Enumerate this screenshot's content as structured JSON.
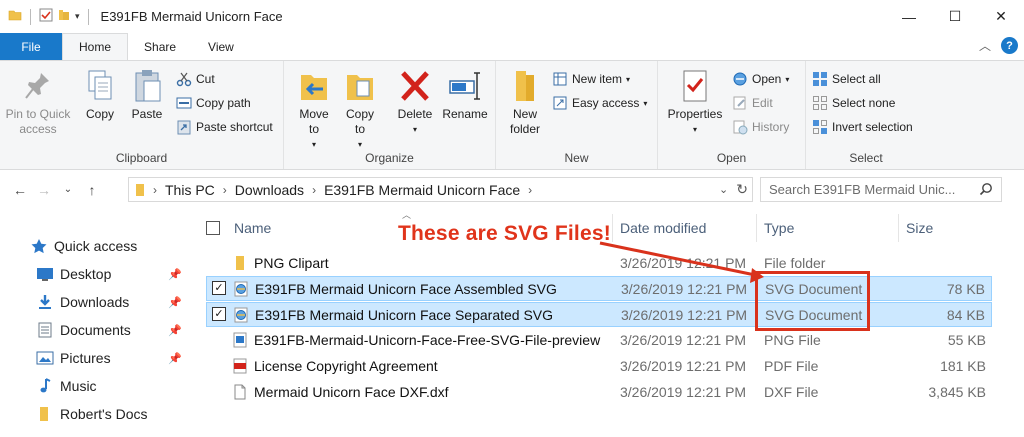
{
  "window": {
    "title": "E391FB Mermaid Unicorn Face",
    "minimize": "—",
    "maximize": "☐",
    "close": "✕"
  },
  "tabs": [
    "File",
    "Home",
    "Share",
    "View"
  ],
  "ribbon": {
    "clipboard": {
      "label": "Clipboard",
      "pin_quick_access": "Pin to Quick access",
      "copy": "Copy",
      "paste": "Paste",
      "cut": "Cut",
      "copy_path": "Copy path",
      "paste_shortcut": "Paste shortcut"
    },
    "organize": {
      "label": "Organize",
      "move_to": "Move to",
      "copy_to": "Copy to",
      "delete": "Delete",
      "rename": "Rename"
    },
    "new": {
      "label": "New",
      "new_folder": "New folder",
      "new_item": "New item",
      "easy_access": "Easy access"
    },
    "open": {
      "label": "Open",
      "properties": "Properties",
      "open": "Open",
      "edit": "Edit",
      "history": "History"
    },
    "select": {
      "label": "Select",
      "select_all": "Select all",
      "select_none": "Select none",
      "invert_selection": "Invert selection"
    }
  },
  "address": {
    "crumbs": [
      "This PC",
      "Downloads",
      "E391FB Mermaid Unicorn Face"
    ],
    "search_placeholder": "Search E391FB Mermaid Unic..."
  },
  "navpane": {
    "quick_access": "Quick access",
    "items": [
      "Desktop",
      "Downloads",
      "Documents",
      "Pictures",
      "Music",
      "Robert's Docs"
    ]
  },
  "columns": {
    "name": "Name",
    "date": "Date modified",
    "type": "Type",
    "size": "Size"
  },
  "files": [
    {
      "name": "PNG Clipart",
      "date": "3/26/2019 12:21 PM",
      "type": "File folder",
      "size": "",
      "icon": "folder-icon",
      "selected": false
    },
    {
      "name": "E391FB Mermaid Unicorn Face Assembled SVG",
      "date": "3/26/2019 12:21 PM",
      "type": "SVG Document",
      "size": "78 KB",
      "icon": "svg-file-icon",
      "selected": true
    },
    {
      "name": "E391FB Mermaid Unicorn Face Separated SVG",
      "date": "3/26/2019 12:21 PM",
      "type": "SVG Document",
      "size": "84 KB",
      "icon": "svg-file-icon",
      "selected": true
    },
    {
      "name": "E391FB-Mermaid-Unicorn-Face-Free-SVG-File-preview",
      "date": "3/26/2019 12:21 PM",
      "type": "PNG File",
      "size": "55 KB",
      "icon": "png-file-icon",
      "selected": false
    },
    {
      "name": "License Copyright Agreement",
      "date": "3/26/2019 12:21 PM",
      "type": "PDF File",
      "size": "181 KB",
      "icon": "pdf-file-icon",
      "selected": false
    },
    {
      "name": "Mermaid Unicorn Face DXF.dxf",
      "date": "3/26/2019 12:21 PM",
      "type": "DXF File",
      "size": "3,845 KB",
      "icon": "blank-file-icon",
      "selected": false
    }
  ],
  "annotation": {
    "text": "These are SVG Files!",
    "color": "#e0341b"
  },
  "colors": {
    "accent": "#1979ca",
    "selection": "#cce8ff",
    "folder": "#f0c14b"
  }
}
